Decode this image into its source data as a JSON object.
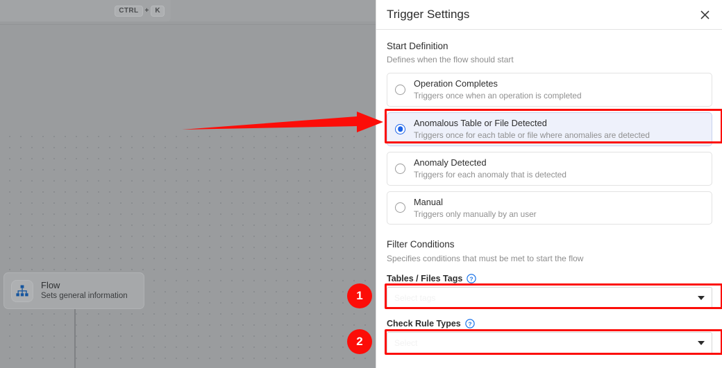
{
  "canvas": {
    "shortcut": {
      "key1": "CTRL",
      "plus": "+",
      "key2": "K"
    },
    "node": {
      "icon": "sitemap-icon",
      "title": "Flow",
      "subtitle": "Sets general information"
    }
  },
  "panel": {
    "title": "Trigger Settings",
    "close_icon": "close-icon",
    "start_definition": {
      "title": "Start Definition",
      "subtitle": "Defines when the flow should start",
      "options": [
        {
          "title": "Operation Completes",
          "subtitle": "Triggers once when an operation is completed",
          "selected": false
        },
        {
          "title": "Anomalous Table or File Detected",
          "subtitle": "Triggers once for each table or file where anomalies are detected",
          "selected": true
        },
        {
          "title": "Anomaly Detected",
          "subtitle": "Triggers for each anomaly that is detected",
          "selected": false
        },
        {
          "title": "Manual",
          "subtitle": "Triggers only manually by an user",
          "selected": false
        }
      ]
    },
    "filter_conditions": {
      "title": "Filter Conditions",
      "subtitle": "Specifies conditions that must be met to start the flow",
      "fields": [
        {
          "label": "Tables / Files Tags",
          "help_icon": "help-circle-icon",
          "value": "",
          "placeholder": "Select tags",
          "caret_icon": "chevron-down-icon"
        },
        {
          "label": "Check Rule Types",
          "help_icon": "help-circle-icon",
          "value": "",
          "placeholder": "Select",
          "caret_icon": "chevron-down-icon"
        }
      ]
    }
  },
  "annotations": {
    "arrow": {
      "name": "red-arrow-annotation",
      "color": "#fc0d08"
    },
    "badges": [
      {
        "label": "1",
        "color": "#fc0d08"
      },
      {
        "label": "2",
        "color": "#fc0d08"
      }
    ],
    "highlight_color": "#fc0d08"
  }
}
